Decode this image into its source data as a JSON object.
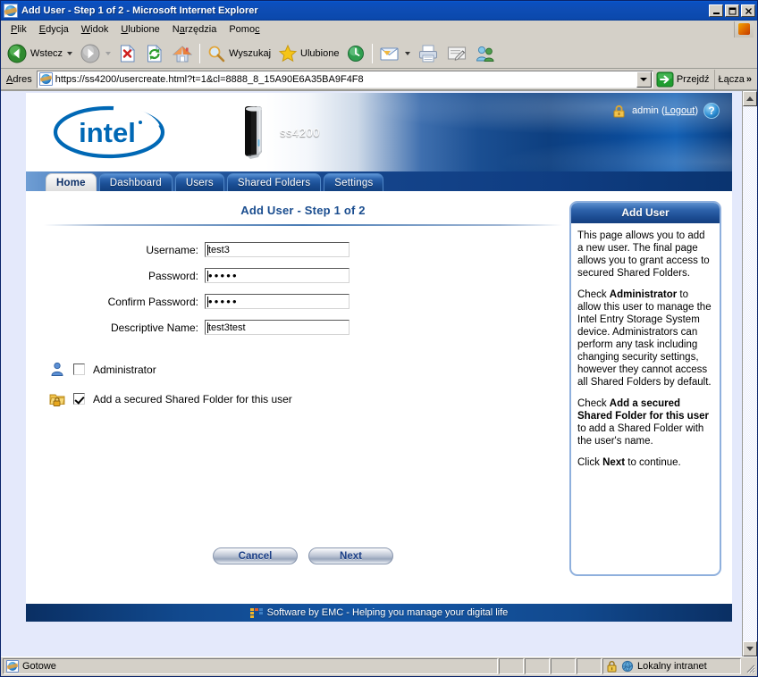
{
  "window": {
    "title": "Add User - Step 1 of 2 - Microsoft Internet Explorer",
    "icon": "ie-page-icon",
    "minimize_label": "Minimize",
    "maximize_label": "Maximize",
    "close_label": "Close"
  },
  "menu": {
    "items": [
      {
        "label": "Plik",
        "accel": "P"
      },
      {
        "label": "Edycja",
        "accel": "E"
      },
      {
        "label": "Widok",
        "accel": "W"
      },
      {
        "label": "Ulubione",
        "accel": "U"
      },
      {
        "label": "Narzędzia",
        "accel": "N"
      },
      {
        "label": "Pomoc",
        "accel": "c"
      }
    ]
  },
  "toolbar": {
    "back_label": "Wstecz",
    "forward_label": "",
    "stop_label": "",
    "refresh_label": "",
    "home_label": "",
    "search_label": "Wyszukaj",
    "favorites_label": "Ulubione",
    "history_label": "",
    "mail_label": "",
    "print_label": "",
    "edit_label": "",
    "messenger_label": ""
  },
  "address": {
    "label": "Adres",
    "url": "https://ss4200/usercreate.html?t=1&cl=8888_8_15A90E6A35BA9F4F8",
    "go_label": "Przejdź",
    "links_label": "Łącza",
    "overflow_label": "»"
  },
  "app": {
    "brand": "intel",
    "device_name": "ss4200",
    "user": {
      "name": "admin",
      "logout_label": "Logout",
      "help_label": "?"
    },
    "tabs": [
      {
        "label": "Home",
        "active": true
      },
      {
        "label": "Dashboard",
        "active": false
      },
      {
        "label": "Users",
        "active": false
      },
      {
        "label": "Shared Folders",
        "active": false
      },
      {
        "label": "Settings",
        "active": false
      }
    ],
    "form": {
      "title": "Add User - Step 1 of 2",
      "fields": [
        {
          "label": "Username:",
          "value": "test3",
          "type": "text"
        },
        {
          "label": "Password:",
          "value": "•••••",
          "type": "password"
        },
        {
          "label": "Confirm Password:",
          "value": "•••••",
          "type": "password"
        },
        {
          "label": "Descriptive Name:",
          "value": "test3test",
          "type": "text"
        }
      ],
      "checkboxes": [
        {
          "label": "Administrator",
          "checked": false,
          "icon": "user-icon"
        },
        {
          "label": "Add a secured Shared Folder for this user",
          "checked": true,
          "icon": "locked-folder-icon"
        }
      ],
      "cancel_label": "Cancel",
      "next_label": "Next"
    },
    "help": {
      "title": "Add User",
      "paragraphs": [
        "This page allows you to add a new user. The final page allows you to grant access to secured Shared Folders.",
        "Check Administrator to allow this user to manage the Intel Entry Storage System device. Administrators can perform any task including changing security settings, however they cannot access all Shared Folders by default.",
        "Check Add a secured Shared Folder for this user to add a Shared Folder with the user's name.",
        "Click Next to continue."
      ]
    },
    "footer_text": "Software by EMC - Helping you manage your digital life"
  },
  "status": {
    "message": "Gotowe",
    "zone": "Lokalny intranet",
    "secure_icon": "lock-icon"
  },
  "colors": {
    "title_blue": "#0a4fc0",
    "intel_blue": "#0068b5",
    "header_blue": "#1b4f92",
    "tab_blue": "#1a4e94",
    "link_blue": "#1a4d8f",
    "footer_blue": "#1557a6",
    "page_bg": "#e4e9fb"
  }
}
